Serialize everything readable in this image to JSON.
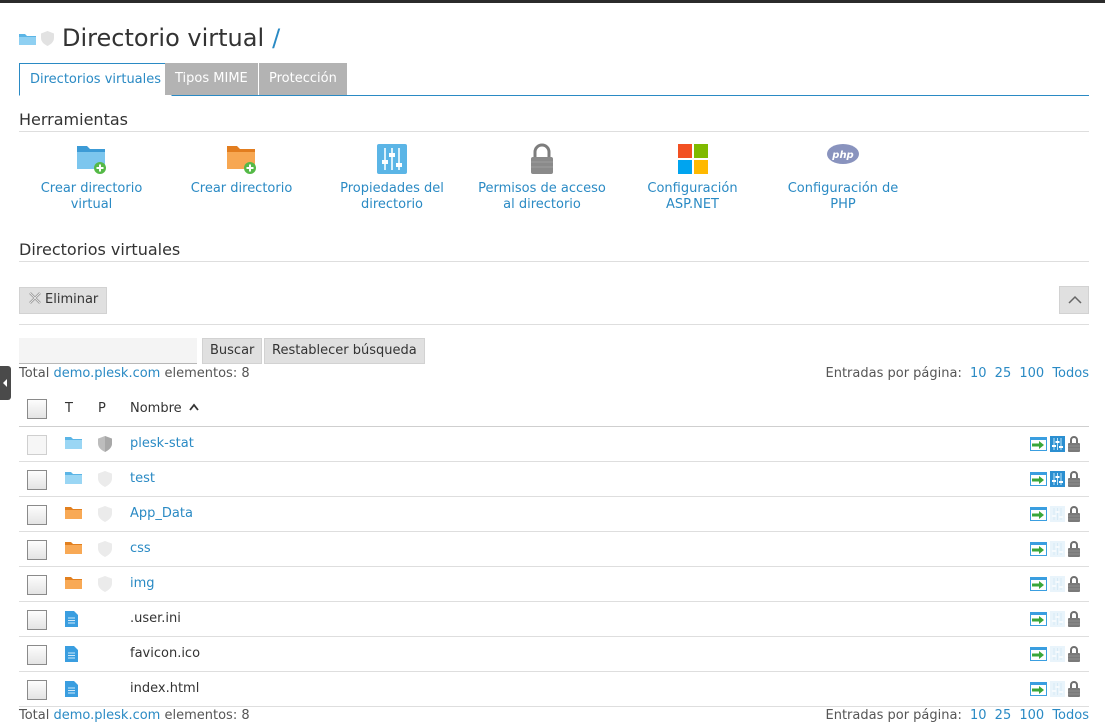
{
  "page": {
    "title": "Directorio virtual",
    "path_slash": "/"
  },
  "tabs": [
    {
      "label": "Directorios virtuales",
      "active": true
    },
    {
      "label": "Tipos MIME",
      "active": false
    },
    {
      "label": "Protección",
      "active": false
    }
  ],
  "tools": {
    "heading": "Herramientas",
    "items": [
      {
        "label": "Crear directorio virtual",
        "icon": "folder-add-icon"
      },
      {
        "label": "Crear directorio",
        "icon": "folder-orange-add-icon"
      },
      {
        "label": "Propiedades del directorio",
        "icon": "properties-sliders-icon"
      },
      {
        "label": "Permisos de acceso al directorio",
        "icon": "lock-icon"
      },
      {
        "label": "Configuración ASP.NET",
        "icon": "windows-logo-icon"
      },
      {
        "label": "Configuración de PHP",
        "icon": "php-icon"
      }
    ]
  },
  "list": {
    "heading": "Directorios virtuales",
    "delete_label": "Eliminar",
    "search_placeholder": "",
    "search_label": "Buscar",
    "reset_label": "Restablecer búsqueda",
    "total_prefix": "Total",
    "total_domain": "demo.plesk.com",
    "total_suffix": "elementos: 8",
    "per_page_label": "Entradas por página:",
    "per_page_options": [
      "10",
      "25",
      "100",
      "Todos"
    ],
    "columns": {
      "t": "T",
      "p": "P",
      "name": "Nombre"
    },
    "rows": [
      {
        "name": "plesk-stat",
        "type": "folder-blue",
        "protected": true,
        "link": true,
        "props_active": true,
        "checkbox_disabled": true
      },
      {
        "name": "test",
        "type": "folder-blue",
        "protected": false,
        "link": true,
        "props_active": true,
        "checkbox_disabled": false
      },
      {
        "name": "App_Data",
        "type": "folder-orange",
        "protected": false,
        "link": true,
        "props_active": false,
        "checkbox_disabled": false
      },
      {
        "name": "css",
        "type": "folder-orange",
        "protected": false,
        "link": true,
        "props_active": false,
        "checkbox_disabled": false
      },
      {
        "name": "img",
        "type": "folder-orange",
        "protected": false,
        "link": true,
        "props_active": false,
        "checkbox_disabled": false
      },
      {
        "name": ".user.ini",
        "type": "file",
        "protected": null,
        "link": false,
        "props_active": false,
        "checkbox_disabled": false
      },
      {
        "name": "favicon.ico",
        "type": "file",
        "protected": null,
        "link": false,
        "props_active": false,
        "checkbox_disabled": false
      },
      {
        "name": "index.html",
        "type": "file",
        "protected": null,
        "link": false,
        "props_active": false,
        "checkbox_disabled": false
      }
    ]
  },
  "colors": {
    "link": "#2a8ac4",
    "folder_blue": "#5bb5e6",
    "folder_orange": "#f39a3d",
    "add_green": "#55b947",
    "tab_inactive": "#b3b3b3"
  }
}
